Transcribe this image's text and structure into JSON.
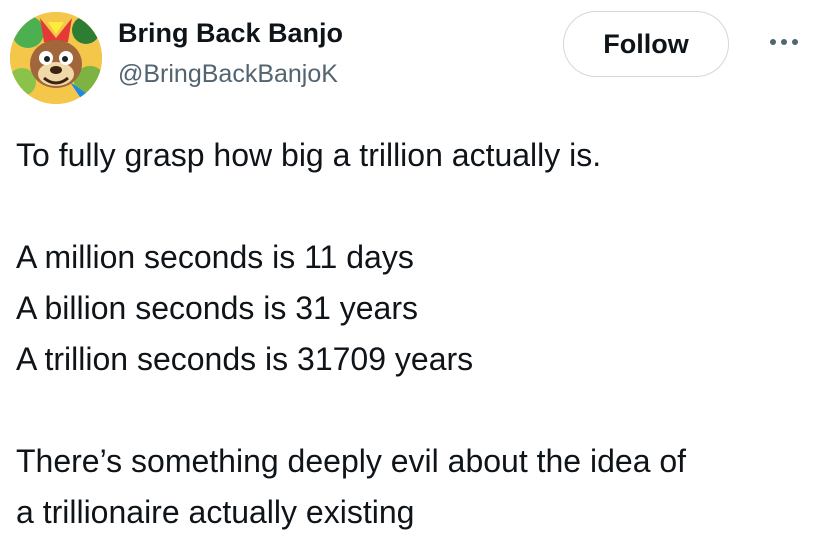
{
  "author": {
    "display_name": "Bring Back Banjo",
    "handle": "@BringBackBanjoK",
    "avatar_icon": "character-avatar"
  },
  "actions": {
    "follow_label": "Follow",
    "more_icon": "more-options-icon"
  },
  "tweet": {
    "line1": "To fully grasp how big a trillion actually is.",
    "line2": "A million seconds is 11 days",
    "line3": "A billion seconds is 31 years",
    "line4": "A trillion seconds is 31709 years",
    "line5": "There’s something deeply evil about the idea of",
    "line6": "a trillionaire actually existing"
  },
  "colors": {
    "text": "#0f1419",
    "secondary": "#536471",
    "border": "#cfd9de"
  }
}
